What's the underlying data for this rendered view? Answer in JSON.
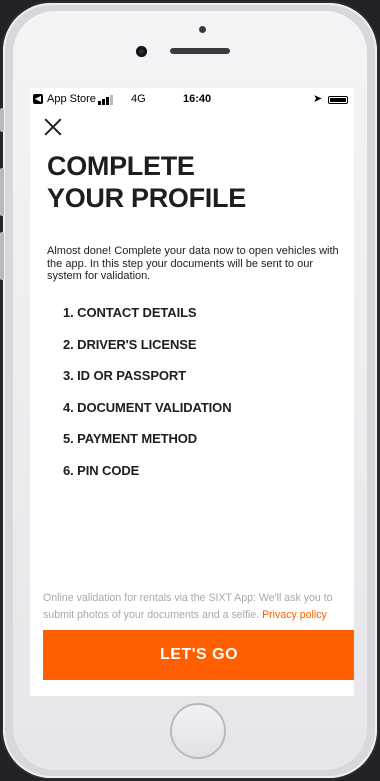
{
  "status_bar": {
    "back_app": "App Store",
    "network": "4G",
    "time": "16:40"
  },
  "title_line1": "COMPLETE",
  "title_line2": "YOUR PROFILE",
  "intro_text": "Almost done! Complete your data now to open vehicles with the app. In this step your documents will be sent to our system for validation.",
  "steps": [
    "1. CONTACT DETAILS",
    "2. DRIVER'S LICENSE",
    "3. ID OR PASSPORT",
    "4. DOCUMENT VALIDATION",
    "5. PAYMENT METHOD",
    "6. PIN CODE"
  ],
  "footer": {
    "note": "Online validation for rentals via the SIXT App: We'll ask you to submit photos of your documents and a selfie.",
    "privacy_link": "Privacy policy"
  },
  "cta_label": "LET'S GO",
  "colors": {
    "accent": "#ff5f00",
    "text": "#1e1e1e",
    "muted": "#a9a9a9"
  }
}
